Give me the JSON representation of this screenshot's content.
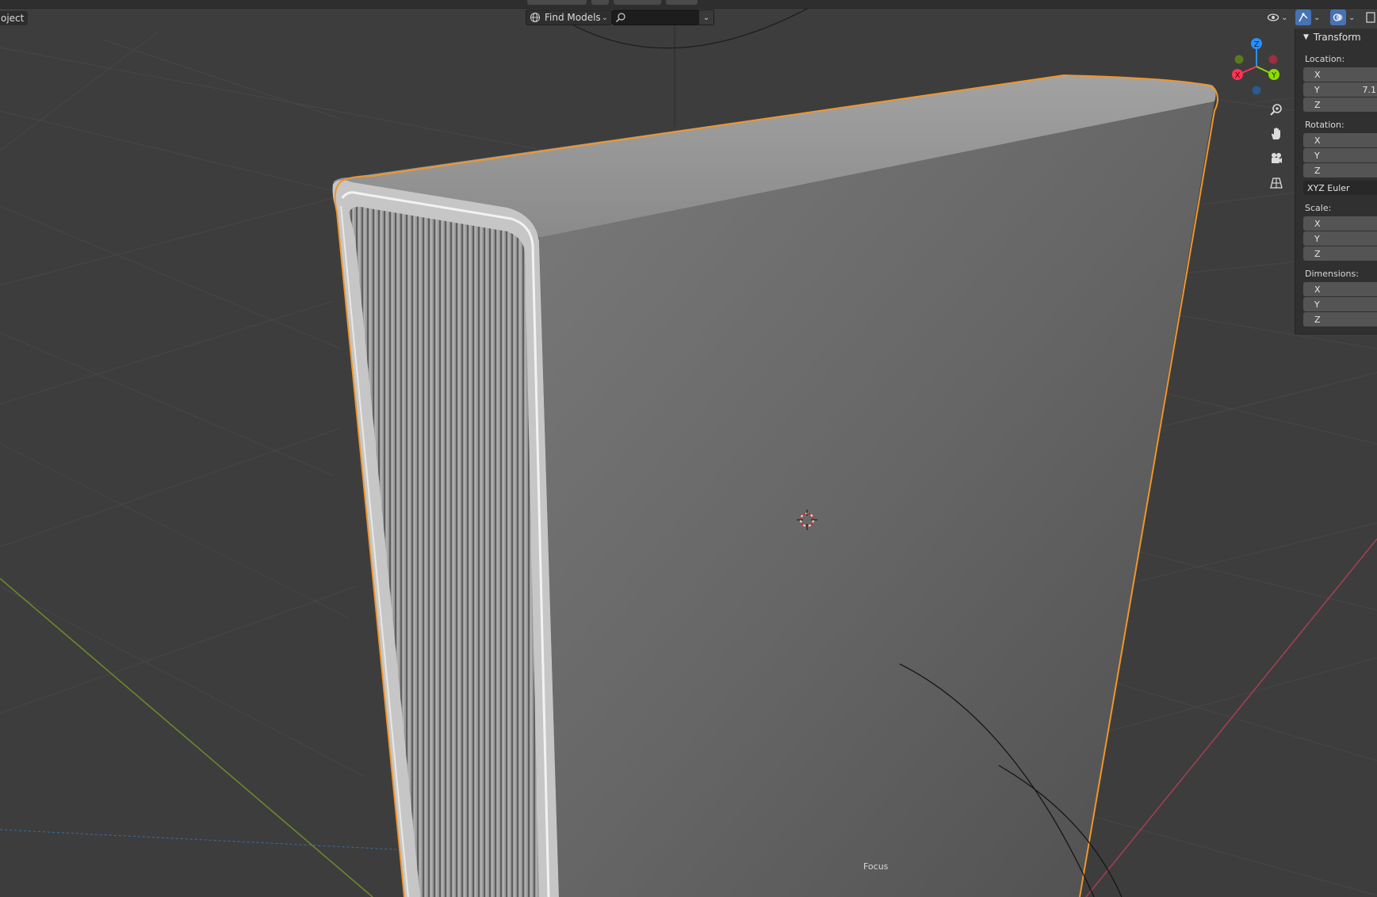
{
  "header": {
    "mode_label": "oject",
    "find_models_label": "Find Models",
    "search_placeholder": "",
    "search_value": ""
  },
  "viewport": {
    "focus_label": "Focus",
    "gizmo_axes": {
      "x": "X",
      "y": "Y",
      "z": "Z"
    },
    "colors": {
      "x_axis": "#ff3352",
      "y_axis": "#8bdc00",
      "z_axis": "#2890ff",
      "selection_outline": "#f0962a",
      "active_header_button": "#4772b3"
    },
    "icons": [
      "visibility-icon",
      "gizmo-toggle-icon",
      "overlay-toggle-icon",
      "zoom-icon",
      "pan-hand-icon",
      "camera-icon",
      "perspective-grid-icon",
      "3d-cursor-icon"
    ]
  },
  "npanel": {
    "transform_title": "Transform",
    "location": {
      "label": "Location:",
      "x": "X",
      "y": "Y",
      "z": "Z",
      "y_value": "7.1"
    },
    "rotation": {
      "label": "Rotation:",
      "x": "X",
      "y": "Y",
      "z": "Z",
      "mode": "XYZ Euler"
    },
    "scale": {
      "label": "Scale:",
      "x": "X",
      "y": "Y",
      "z": "Z"
    },
    "dimensions": {
      "label": "Dimensions:",
      "x": "X",
      "y": "Y",
      "z": "Z"
    }
  }
}
